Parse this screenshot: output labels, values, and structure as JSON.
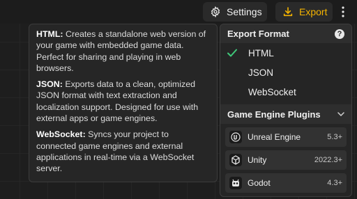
{
  "toolbar": {
    "settings_label": "Settings",
    "export_label": "Export",
    "accent": "#f5b400"
  },
  "tooltip": {
    "items": [
      {
        "name": "HTML:",
        "text": " Creates a standalone web version of your game with embedded game data. Perfect for sharing and playing in web browsers."
      },
      {
        "name": "JSON:",
        "text": " Exports data to a clean, optimized JSON format with text extraction and localization support. Designed for use with external apps or game engines."
      },
      {
        "name": "WebSocket:",
        "text": " Syncs your project to connected game engines and external applications in real-time via a WebSocket server."
      }
    ]
  },
  "menu": {
    "export_format_title": "Export Format",
    "help_symbol": "?",
    "formats": [
      {
        "label": "HTML",
        "selected": true
      },
      {
        "label": "JSON",
        "selected": false
      },
      {
        "label": "WebSocket",
        "selected": false
      }
    ],
    "plugins_title": "Game Engine Plugins",
    "plugins": [
      {
        "name": "Unreal Engine",
        "version": "5.3+",
        "icon": "unreal-icon"
      },
      {
        "name": "Unity",
        "version": "2022.3+",
        "icon": "unity-icon"
      },
      {
        "name": "Godot",
        "version": "4.3+",
        "icon": "godot-icon"
      }
    ]
  }
}
